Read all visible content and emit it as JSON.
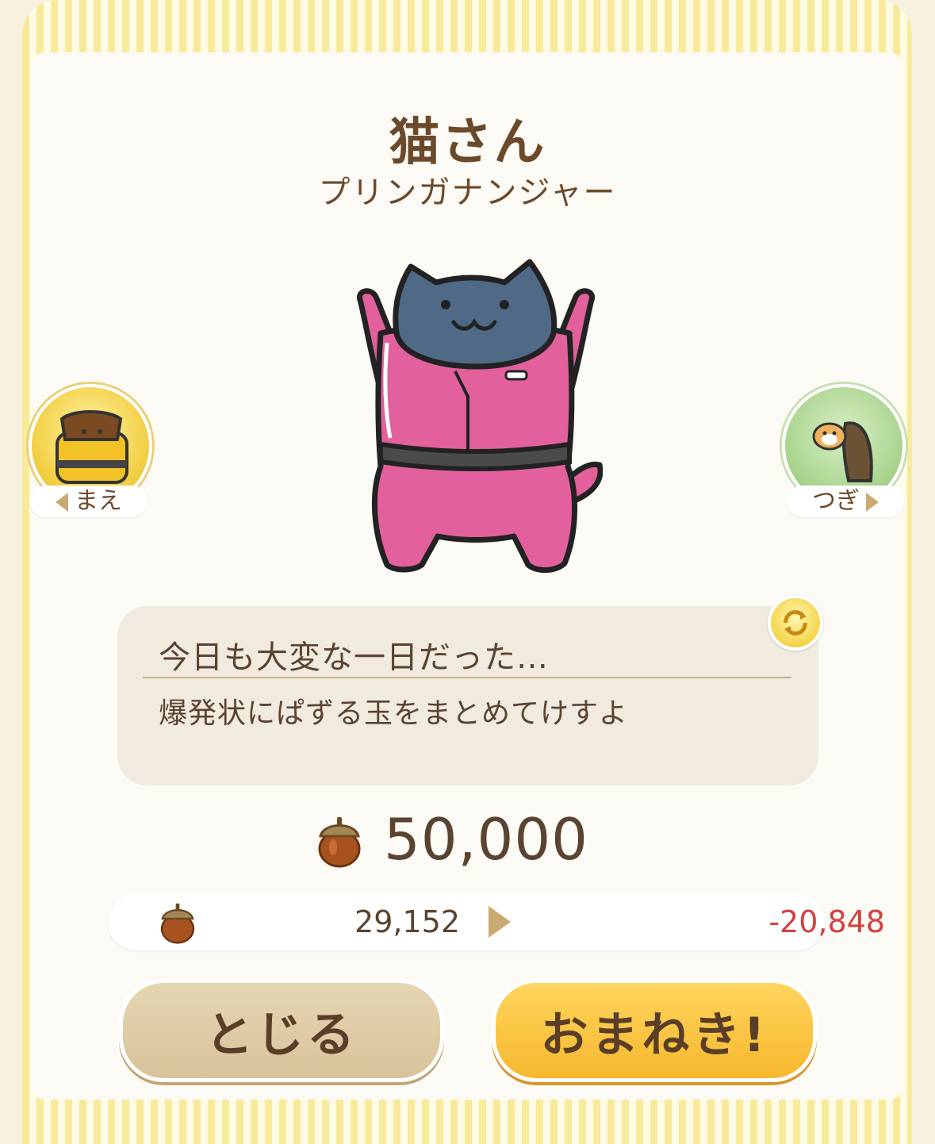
{
  "header": {
    "title": "猫さん",
    "subtitle": "プリンガナンジャー"
  },
  "nav": {
    "prev_label": "まえ",
    "next_label": "つぎ"
  },
  "message": {
    "line1": "今日も大変な一日だった…",
    "line2": "爆発状にぱずる玉をまとめてけすよ"
  },
  "price": {
    "value": "50,000",
    "icon": "acorn-icon"
  },
  "balance": {
    "current": "29,152",
    "after": "-20,848"
  },
  "buttons": {
    "close": "とじる",
    "invite": "おまねき!"
  },
  "colors": {
    "brown_text": "#6b4a2b",
    "negative": "#d24141",
    "invite_button": "#f6b82e",
    "close_button": "#d7c39a",
    "character_suit": "#e2609b",
    "character_head": "#4e6a86"
  }
}
